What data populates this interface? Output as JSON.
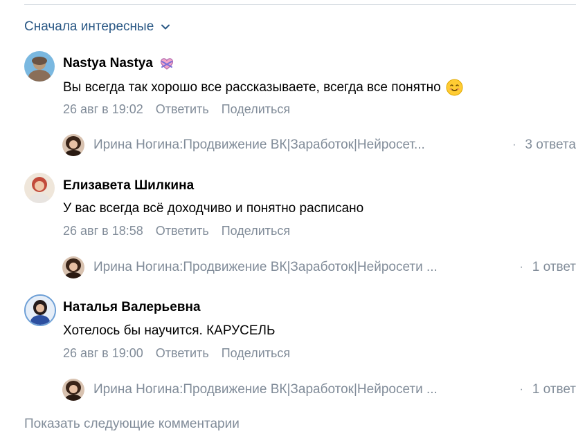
{
  "sort": {
    "label": "Сначала интересные",
    "icon": "chevron-down-icon"
  },
  "comments": [
    {
      "author": "Nastya Nastya",
      "author_badge_icon": "heart-ribbon-icon",
      "text": "Вы всегда так хорошо все рассказываете, всегда все понятно",
      "text_emoji_icon": "smiling-face-icon",
      "date": "26 авг в 19:02",
      "reply_label": "Ответить",
      "share_label": "Поделиться",
      "thread": {
        "author": "Ирина Ногина:Продвижение ВК|Заработок|Нейросет...",
        "separator": "·",
        "count": "3 ответа"
      }
    },
    {
      "author": "Елизавета Шилкина",
      "text": "У вас всегда всё доходчиво и понятно расписано",
      "date": "26 авг в 18:58",
      "reply_label": "Ответить",
      "share_label": "Поделиться",
      "thread": {
        "author": "Ирина Ногина:Продвижение ВК|Заработок|Нейросети ...",
        "separator": "·",
        "count": "1 ответ"
      }
    },
    {
      "author": "Наталья Валерьевна",
      "text": "Хотелось бы научится. КАРУСЕЛЬ",
      "date": "26 авг в 19:00",
      "reply_label": "Ответить",
      "share_label": "Поделиться",
      "thread": {
        "author": "Ирина Ногина:Продвижение ВК|Заработок|Нейросети ...",
        "separator": "·",
        "count": "1 ответ"
      }
    }
  ],
  "show_more_label": "Показать следующие комментарии",
  "colors": {
    "link": "#2a5885",
    "secondary": "#818c99",
    "divider": "#dce1e6"
  }
}
